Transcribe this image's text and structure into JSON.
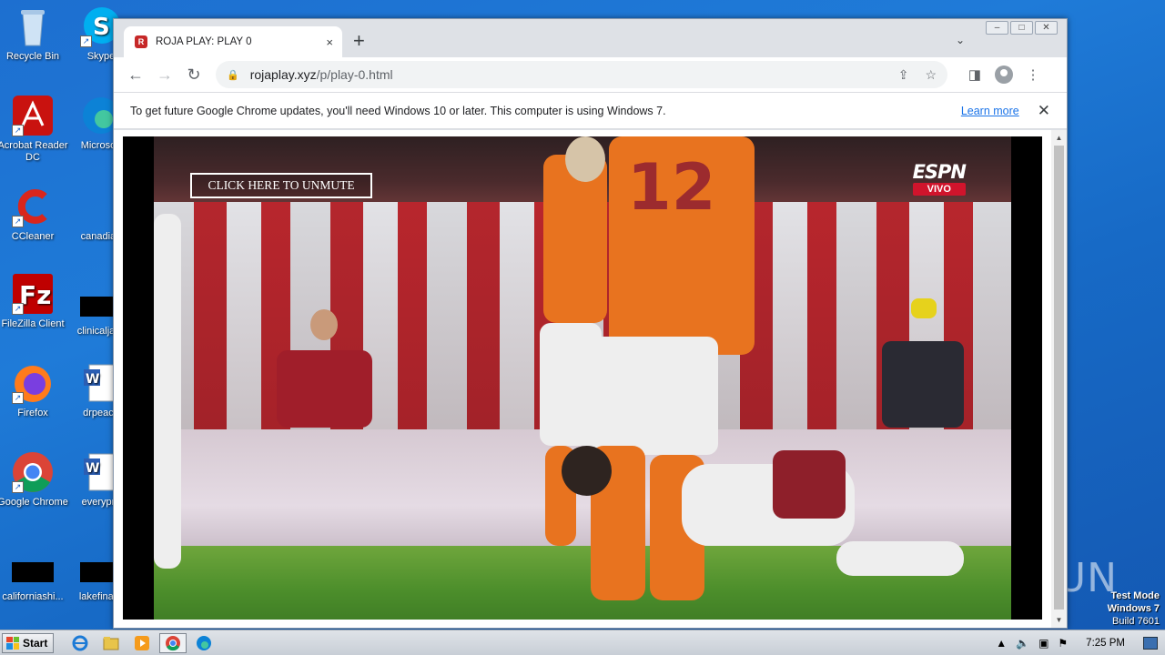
{
  "desktop": {
    "icons": [
      {
        "label": "Recycle Bin",
        "icon": "recycle-bin-icon"
      },
      {
        "label": "Acrobat Reader DC",
        "icon": "acrobat-icon"
      },
      {
        "label": "CCleaner",
        "icon": "ccleaner-icon"
      },
      {
        "label": "FileZilla Client",
        "icon": "filezilla-icon"
      },
      {
        "label": "Firefox",
        "icon": "firefox-icon"
      },
      {
        "label": "Google Chrome",
        "icon": "chrome-icon"
      },
      {
        "label": "californiashi...",
        "icon": "file-icon"
      },
      {
        "label": "Skype",
        "icon": "skype-icon"
      },
      {
        "label": "Microsoft",
        "icon": "edge-icon"
      },
      {
        "label": "canadian",
        "icon": "file-icon"
      },
      {
        "label": "clinicaljack",
        "icon": "file-icon"
      },
      {
        "label": "drpeace",
        "icon": "word-doc-icon"
      },
      {
        "label": "everypre",
        "icon": "word-doc-icon"
      },
      {
        "label": "lakefinally",
        "icon": "file-icon"
      }
    ],
    "watermark": "ANY RUN",
    "test_mode": {
      "line1": "Test Mode",
      "line2": "Windows 7",
      "line3": "Build 7601"
    }
  },
  "browser": {
    "tab": {
      "title": "ROJA PLAY: PLAY 0",
      "favicon": "R",
      "close": "×"
    },
    "new_tab": "+",
    "tab_menu": "⌄",
    "window_controls": {
      "minimize": "–",
      "maximize": "□",
      "close": "✕"
    },
    "nav": {
      "back": "←",
      "forward": "→",
      "reload": "↻"
    },
    "url": {
      "domain": "rojaplay.xyz",
      "path": "/p/play-0.html"
    },
    "infobar": {
      "message": "To get future Google Chrome updates, you'll need Windows 10 or later. This computer is using Windows 7.",
      "link": "Learn more",
      "close": "✕"
    },
    "video": {
      "unmute_label": "CLICK HERE TO UNMUTE",
      "channel_logo": "ESPN",
      "channel_tag": "VIVO"
    }
  },
  "taskbar": {
    "start_label": "Start",
    "apps": [
      "ie-icon",
      "explorer-icon",
      "media-player-icon",
      "chrome-icon",
      "edge-icon"
    ],
    "clock": "7:25 PM"
  }
}
